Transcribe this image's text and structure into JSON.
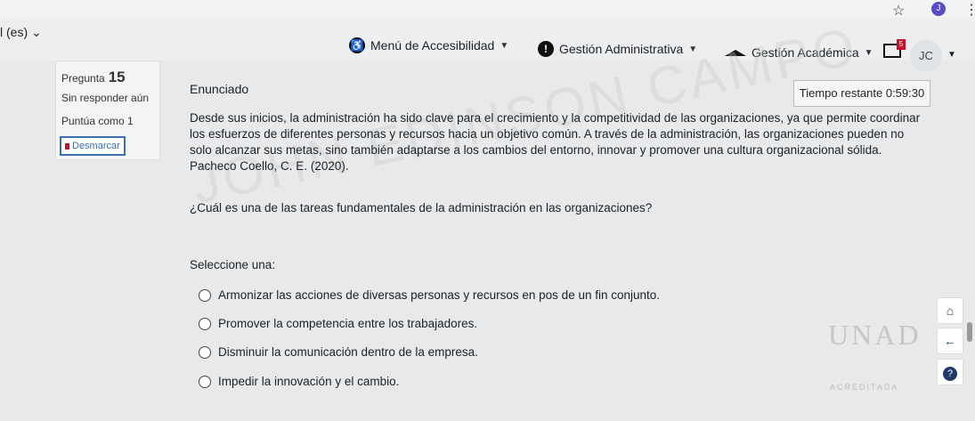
{
  "browser": {
    "star_icon": "star-icon",
    "profile_initial": "J",
    "menu_icon": "kebab-icon"
  },
  "navbar": {
    "language": "l (es) ⌄",
    "accessibility_menu": "Menú de Accesibilidad",
    "admin_management": "Gestión Administrativa",
    "academic_management": "Gestión Académica",
    "mail_badge": "5",
    "user_initials": "JC"
  },
  "info": {
    "question_label": "Pregunta",
    "question_number": "15",
    "state": "Sin responder aún",
    "grade": "Puntúa como 1",
    "flag_button": "Desmarcar"
  },
  "question": {
    "section_title": "Enunciado",
    "timer": "Tiempo restante 0:59:30",
    "stem": "Desde sus inicios, la administración ha sido clave para el crecimiento y la competitividad de las organizaciones, ya que permite coordinar los esfuerzos de diferentes personas y recursos hacia un objetivo común. A través de la administración, las organizaciones pueden no solo alcanzar sus metas, sino también adaptarse a los cambios del entorno, innovar y promover una cultura organizacional sólida. Pacheco Coello, C. E. (2020).",
    "text": "¿Cuál es una de las tareas fundamentales de la administración en las organizaciones?",
    "prompt": "Seleccione una:",
    "options": [
      "Armonizar las acciones de diversas personas y recursos en pos de un fin conjunto.",
      "Promover la competencia entre los trabajadores.",
      "Disminuir la comunicación dentro de la empresa.",
      "Impedir la innovación y el cambio."
    ]
  },
  "watermark": "JOHN EDINSON CAMPO",
  "logo": {
    "mark": "UNAD",
    "sub": "ACREDITADA"
  },
  "colors": {
    "flag_border": "#3a6fb0",
    "flag": "#c8102e",
    "side_icons": "#1d3b66",
    "mail_badge": "#c8102e"
  }
}
